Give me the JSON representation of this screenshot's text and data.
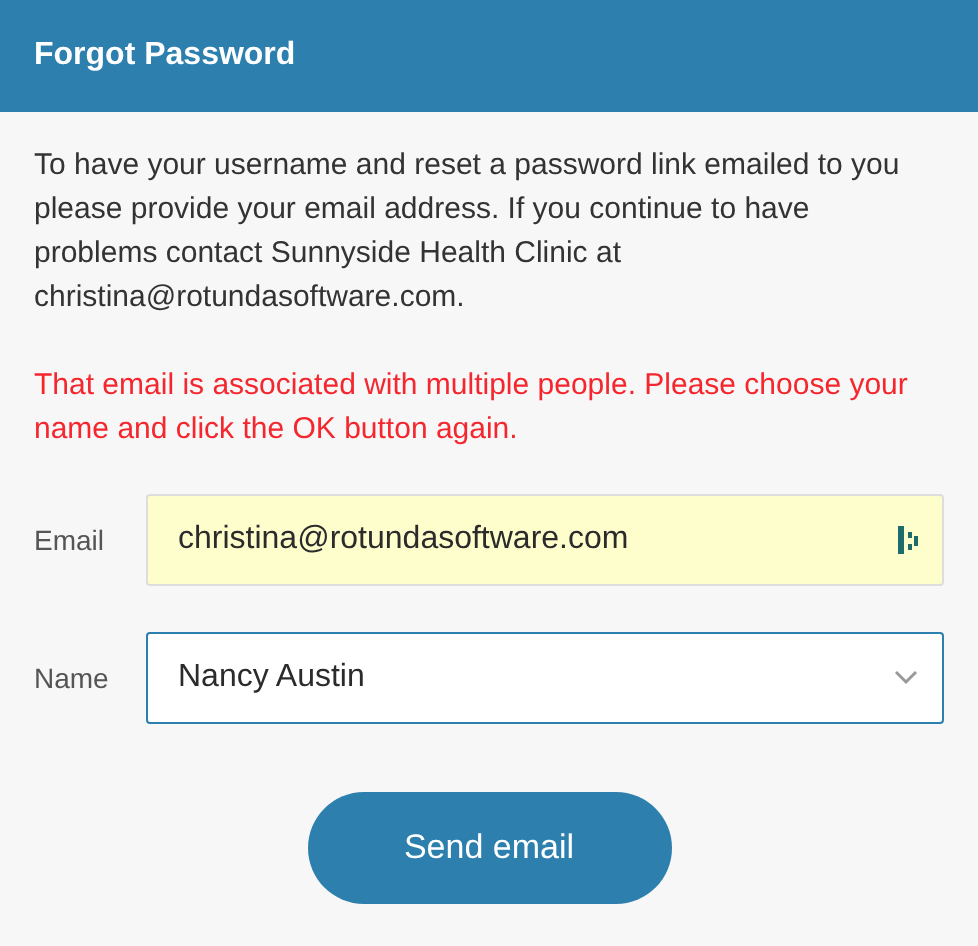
{
  "dialog": {
    "title": "Forgot Password"
  },
  "instructions": "To have your username and reset a password link emailed to you please provide your email address. If you continue to have problems contact Sunnyside Health Clinic at christina@rotundasoftware.com.",
  "error": "That email is associated with multiple people. Please choose your name and click the OK button again.",
  "fields": [
    {
      "kind": "text",
      "label": "Email",
      "value": "christina@rotundasoftware.com",
      "autofilled": true
    },
    {
      "kind": "select",
      "label": "Name",
      "value": "Nancy Austin",
      "autofilled": false
    }
  ],
  "buttons": [
    "Send email"
  ]
}
